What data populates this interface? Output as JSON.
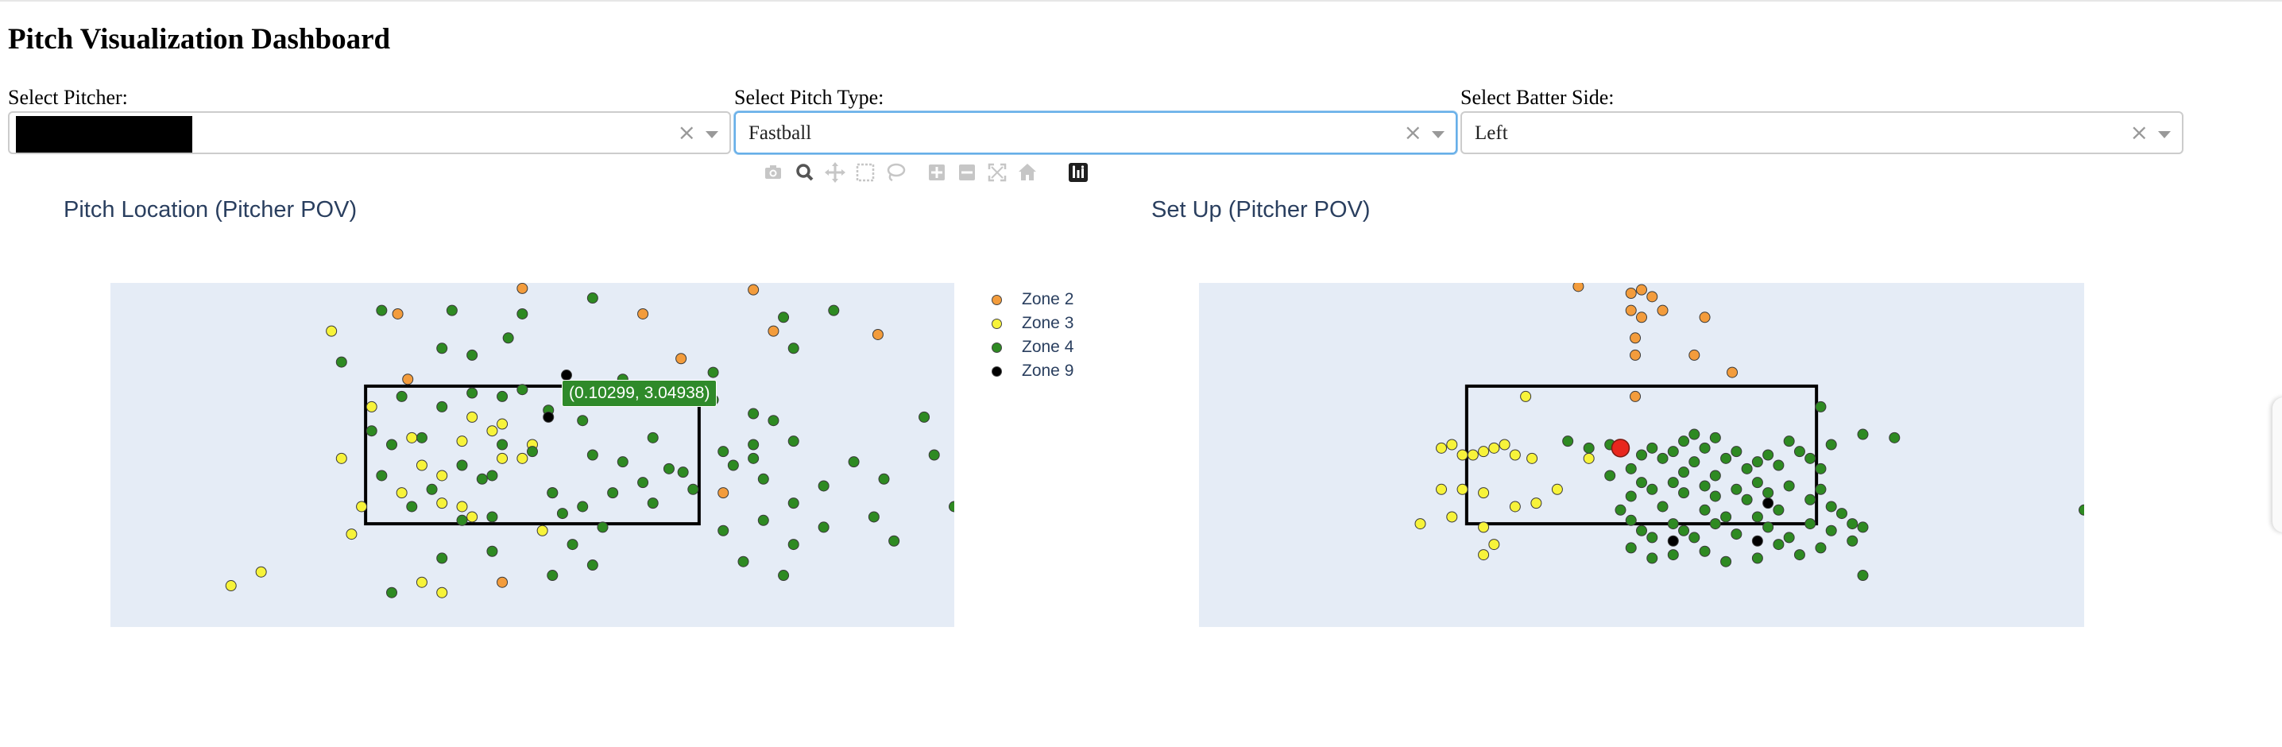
{
  "page_title": "Pitch Visualization Dashboard",
  "filters": {
    "pitcher": {
      "label": "Select Pitcher:",
      "value": ""
    },
    "pitch_type": {
      "label": "Select Pitch Type:",
      "value": "Fastball"
    },
    "batter_side": {
      "label": "Select Batter Side:",
      "value": "Left"
    },
    "clear_glyph": "×"
  },
  "modebar": [
    "camera-icon",
    "zoom-icon",
    "pan-icon",
    "box-select-icon",
    "lasso-icon",
    "zoom-in-icon",
    "zoom-out-icon",
    "autoscale-icon",
    "reset-axes-icon",
    "plotly-logo-icon"
  ],
  "colors": {
    "plot_bg": "#e5ecf6",
    "title": "#2a3f5f",
    "zone2": "#f39c3c",
    "zone3": "#f7f33a",
    "zone4": "#2e8a22",
    "zone9": "#000000",
    "setup_marker": "#e8271e"
  },
  "tooltip": "(0.10299, 3.04938)",
  "chart_data": [
    {
      "type": "scatter",
      "title": "Pitch Location (Pitcher POV)",
      "xlabel": "",
      "ylabel": "",
      "grid": false,
      "xlim": [
        -2.1,
        2.1
      ],
      "ylim": [
        0.0,
        5.0
      ],
      "strike_zone": {
        "x": [
          -0.83,
          0.83
        ],
        "y": [
          1.5,
          3.5
        ]
      },
      "legend": {
        "position": "right"
      },
      "series": [
        {
          "name": "Zone 2",
          "color": "#f39c3c",
          "points": [
            [
              -0.67,
              4.55
            ],
            [
              -0.05,
              4.92
            ],
            [
              0.55,
              4.55
            ],
            [
              1.1,
              4.9
            ],
            [
              1.72,
              4.25
            ],
            [
              -0.62,
              3.6
            ],
            [
              0.74,
              3.9
            ],
            [
              1.2,
              4.3
            ],
            [
              0.95,
              1.95
            ],
            [
              -0.15,
              0.65
            ]
          ]
        },
        {
          "name": "Zone 3",
          "color": "#f7f33a",
          "points": [
            [
              -1.0,
              4.3
            ],
            [
              -0.6,
              2.75
            ],
            [
              -0.2,
              2.85
            ],
            [
              -0.35,
              2.7
            ],
            [
              -0.8,
              3.2
            ],
            [
              -0.95,
              2.45
            ],
            [
              -0.15,
              2.45
            ],
            [
              0.0,
              2.65
            ],
            [
              -0.35,
              1.75
            ],
            [
              -0.3,
              1.6
            ],
            [
              -0.45,
              2.2
            ],
            [
              0.1,
              1.95
            ],
            [
              -0.05,
              2.45
            ],
            [
              -0.85,
              1.75
            ],
            [
              -1.35,
              0.8
            ],
            [
              -0.55,
              2.35
            ],
            [
              -0.65,
              1.95
            ],
            [
              -0.45,
              1.8
            ],
            [
              0.05,
              1.4
            ],
            [
              -0.9,
              1.35
            ],
            [
              -1.5,
              0.6
            ],
            [
              -0.55,
              0.65
            ],
            [
              -0.45,
              0.5
            ],
            [
              -0.3,
              3.05
            ],
            [
              -0.15,
              2.95
            ]
          ]
        },
        {
          "name": "Zone 4",
          "color": "#2e8a22",
          "points": [
            [
              -0.75,
              4.6
            ],
            [
              -0.4,
              4.6
            ],
            [
              -0.05,
              4.55
            ],
            [
              0.3,
              4.78
            ],
            [
              -0.12,
              4.2
            ],
            [
              -0.3,
              3.95
            ],
            [
              -0.45,
              4.05
            ],
            [
              -0.65,
              3.35
            ],
            [
              -0.45,
              3.2
            ],
            [
              -0.15,
              3.35
            ],
            [
              0.08,
              3.15
            ],
            [
              0.25,
              3.0
            ],
            [
              -0.8,
              2.85
            ],
            [
              -0.55,
              2.75
            ],
            [
              -0.15,
              2.65
            ],
            [
              0.0,
              2.55
            ],
            [
              0.3,
              2.5
            ],
            [
              0.45,
              2.4
            ],
            [
              0.6,
              2.75
            ],
            [
              0.75,
              2.25
            ],
            [
              0.95,
              2.55
            ],
            [
              1.1,
              2.65
            ],
            [
              0.8,
              2.0
            ],
            [
              0.6,
              1.8
            ],
            [
              0.4,
              1.95
            ],
            [
              0.25,
              1.75
            ],
            [
              0.1,
              1.95
            ],
            [
              -0.2,
              2.2
            ],
            [
              -0.35,
              2.35
            ],
            [
              -0.25,
              2.15
            ],
            [
              -0.5,
              2.0
            ],
            [
              -0.6,
              1.75
            ],
            [
              -0.35,
              1.55
            ],
            [
              -0.2,
              1.6
            ],
            [
              0.15,
              1.65
            ],
            [
              0.35,
              1.45
            ],
            [
              -0.7,
              2.65
            ],
            [
              -0.75,
              2.2
            ],
            [
              -0.95,
              3.85
            ],
            [
              -0.3,
              3.4
            ],
            [
              -0.05,
              3.45
            ],
            [
              0.45,
              3.6
            ],
            [
              0.9,
              3.3
            ],
            [
              1.2,
              3.0
            ],
            [
              1.3,
              2.7
            ],
            [
              1.15,
              2.15
            ],
            [
              1.45,
              2.05
            ],
            [
              1.75,
              2.15
            ],
            [
              2.0,
              2.5
            ],
            [
              1.6,
              2.4
            ],
            [
              1.3,
              1.8
            ],
            [
              1.15,
              1.55
            ],
            [
              1.05,
              0.95
            ],
            [
              1.3,
              1.2
            ],
            [
              1.25,
              0.75
            ],
            [
              1.7,
              1.6
            ],
            [
              2.1,
              1.75
            ],
            [
              1.8,
              1.25
            ],
            [
              1.45,
              1.45
            ],
            [
              0.95,
              1.4
            ],
            [
              0.2,
              1.2
            ],
            [
              0.3,
              0.9
            ],
            [
              0.1,
              0.75
            ],
            [
              -0.2,
              1.1
            ],
            [
              -0.45,
              1.0
            ],
            [
              -0.7,
              0.5
            ],
            [
              1.95,
              3.05
            ],
            [
              1.1,
              3.1
            ],
            [
              0.9,
              3.7
            ],
            [
              1.3,
              4.05
            ],
            [
              1.25,
              4.5
            ],
            [
              1.5,
              4.6
            ],
            [
              1.0,
              2.35
            ],
            [
              0.55,
              2.1
            ],
            [
              0.68,
              2.3
            ],
            [
              1.1,
              2.45
            ]
          ]
        },
        {
          "name": "Zone 9",
          "color": "#000000",
          "points": [
            [
              0.17,
              3.66
            ],
            [
              0.08,
              3.05
            ]
          ]
        }
      ]
    },
    {
      "type": "scatter",
      "title": "Set Up (Pitcher POV)",
      "xlabel": "",
      "ylabel": "",
      "grid": false,
      "xlim": [
        -2.1,
        2.1
      ],
      "ylim": [
        0.0,
        5.0
      ],
      "strike_zone": {
        "x": [
          -0.83,
          0.83
        ],
        "y": [
          1.5,
          3.5
        ]
      },
      "setup_target": [
        -0.1,
        2.6
      ],
      "series": [
        {
          "name": "Zone 2",
          "color": "#f39c3c",
          "points": [
            [
              -0.3,
              4.95
            ],
            [
              -0.05,
              4.85
            ],
            [
              0.0,
              4.9
            ],
            [
              0.05,
              4.8
            ],
            [
              0.1,
              4.6
            ],
            [
              0.0,
              4.5
            ],
            [
              -0.05,
              4.6
            ],
            [
              -0.03,
              4.2
            ],
            [
              0.3,
              4.5
            ],
            [
              -0.03,
              3.95
            ],
            [
              0.25,
              3.95
            ],
            [
              0.43,
              3.7
            ],
            [
              -0.03,
              3.35
            ]
          ]
        },
        {
          "name": "Zone 3",
          "color": "#f7f33a",
          "points": [
            [
              -0.55,
              3.35
            ],
            [
              -0.95,
              2.6
            ],
            [
              -0.9,
              2.65
            ],
            [
              -0.85,
              2.5
            ],
            [
              -0.8,
              2.5
            ],
            [
              -0.75,
              2.55
            ],
            [
              -0.7,
              2.6
            ],
            [
              -0.65,
              2.65
            ],
            [
              -0.6,
              2.5
            ],
            [
              -0.52,
              2.45
            ],
            [
              -0.95,
              2.0
            ],
            [
              -0.85,
              2.0
            ],
            [
              -0.75,
              1.95
            ],
            [
              -0.6,
              1.75
            ],
            [
              -0.9,
              1.6
            ],
            [
              -1.05,
              1.5
            ],
            [
              -0.75,
              1.45
            ],
            [
              -0.7,
              1.2
            ],
            [
              -0.75,
              1.05
            ],
            [
              -0.5,
              1.8
            ],
            [
              -0.4,
              2.0
            ],
            [
              -0.25,
              2.45
            ]
          ]
        },
        {
          "name": "Zone 4",
          "color": "#2e8a22",
          "points": [
            [
              -0.35,
              2.7
            ],
            [
              -0.25,
              2.6
            ],
            [
              -0.15,
              2.65
            ],
            [
              0.0,
              2.5
            ],
            [
              0.05,
              2.6
            ],
            [
              0.1,
              2.45
            ],
            [
              0.15,
              2.55
            ],
            [
              0.2,
              2.7
            ],
            [
              0.25,
              2.4
            ],
            [
              0.3,
              2.6
            ],
            [
              0.4,
              2.45
            ],
            [
              0.45,
              2.55
            ],
            [
              0.5,
              2.3
            ],
            [
              0.55,
              2.4
            ],
            [
              0.6,
              2.5
            ],
            [
              0.65,
              2.35
            ],
            [
              0.7,
              2.7
            ],
            [
              0.75,
              2.55
            ],
            [
              0.8,
              2.45
            ],
            [
              0.85,
              2.3
            ],
            [
              0.9,
              2.65
            ],
            [
              0.35,
              2.75
            ],
            [
              0.25,
              2.8
            ],
            [
              -0.05,
              2.3
            ],
            [
              0.0,
              2.1
            ],
            [
              -0.05,
              1.9
            ],
            [
              0.05,
              2.0
            ],
            [
              0.15,
              2.1
            ],
            [
              0.2,
              1.95
            ],
            [
              0.3,
              2.05
            ],
            [
              0.35,
              1.9
            ],
            [
              0.45,
              2.0
            ],
            [
              0.5,
              1.85
            ],
            [
              0.55,
              2.1
            ],
            [
              0.6,
              1.95
            ],
            [
              0.7,
              2.05
            ],
            [
              0.8,
              1.85
            ],
            [
              0.85,
              2.0
            ],
            [
              0.9,
              1.75
            ],
            [
              0.95,
              1.65
            ],
            [
              1.0,
              1.5
            ],
            [
              -0.1,
              1.7
            ],
            [
              -0.05,
              1.55
            ],
            [
              0.0,
              1.4
            ],
            [
              0.05,
              1.3
            ],
            [
              0.15,
              1.5
            ],
            [
              0.2,
              1.4
            ],
            [
              0.25,
              1.3
            ],
            [
              0.35,
              1.5
            ],
            [
              0.45,
              1.35
            ],
            [
              0.55,
              1.6
            ],
            [
              0.6,
              1.45
            ],
            [
              0.7,
              1.3
            ],
            [
              0.8,
              1.5
            ],
            [
              0.9,
              1.4
            ],
            [
              1.0,
              1.25
            ],
            [
              -0.05,
              1.15
            ],
            [
              0.05,
              1.0
            ],
            [
              0.15,
              1.05
            ],
            [
              0.3,
              1.1
            ],
            [
              0.4,
              0.95
            ],
            [
              0.55,
              1.0
            ],
            [
              0.65,
              1.2
            ],
            [
              0.75,
              1.05
            ],
            [
              0.85,
              1.15
            ],
            [
              1.05,
              1.45
            ],
            [
              1.05,
              0.75
            ],
            [
              0.85,
              3.2
            ],
            [
              1.05,
              2.8
            ],
            [
              1.2,
              2.75
            ],
            [
              0.3,
              1.7
            ],
            [
              0.4,
              1.6
            ],
            [
              0.65,
              1.7
            ],
            [
              0.1,
              1.75
            ],
            [
              0.2,
              2.25
            ],
            [
              0.35,
              2.2
            ],
            [
              -0.15,
              2.2
            ],
            [
              2.1,
              1.7
            ]
          ]
        },
        {
          "name": "Zone 9",
          "color": "#000000",
          "points": [
            [
              0.6,
              1.8
            ],
            [
              0.55,
              1.25
            ],
            [
              0.15,
              1.25
            ]
          ]
        }
      ]
    }
  ]
}
